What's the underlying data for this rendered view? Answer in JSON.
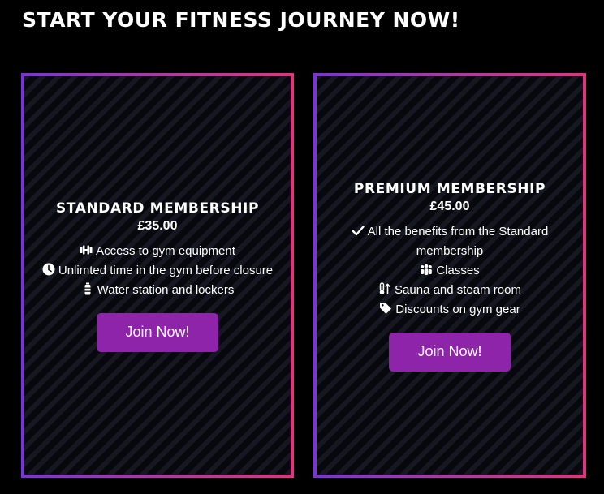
{
  "page": {
    "title": "START YOUR FITNESS JOURNEY NOW!"
  },
  "colors": {
    "background": "#000000",
    "card_background": "#07070e",
    "border_gradient_start": "#7a34d6",
    "border_gradient_end": "#e0347e",
    "button": "#8e24aa",
    "text": "#ffffff"
  },
  "plans": [
    {
      "name": "STANDARD MEMBERSHIP",
      "price": "£35.00",
      "features": [
        {
          "icon": "dumbbell-icon",
          "text": "Access to gym equipment"
        },
        {
          "icon": "clock-icon",
          "text": "Unlimted time in the gym before closure"
        },
        {
          "icon": "water-bottle-icon",
          "text": "Water station and lockers"
        }
      ],
      "button_label": "Join Now!"
    },
    {
      "name": "PREMIUM MEMBERSHIP",
      "price": "£45.00",
      "features": [
        {
          "icon": "check-icon",
          "text": "All the benefits from the Standard membership"
        },
        {
          "icon": "people-group-icon",
          "text": "Classes"
        },
        {
          "icon": "temperature-arrow-up-icon",
          "text": "Sauna and steam room"
        },
        {
          "icon": "tag-icon",
          "text": "Discounts on gym gear"
        }
      ],
      "button_label": "Join Now!"
    }
  ]
}
